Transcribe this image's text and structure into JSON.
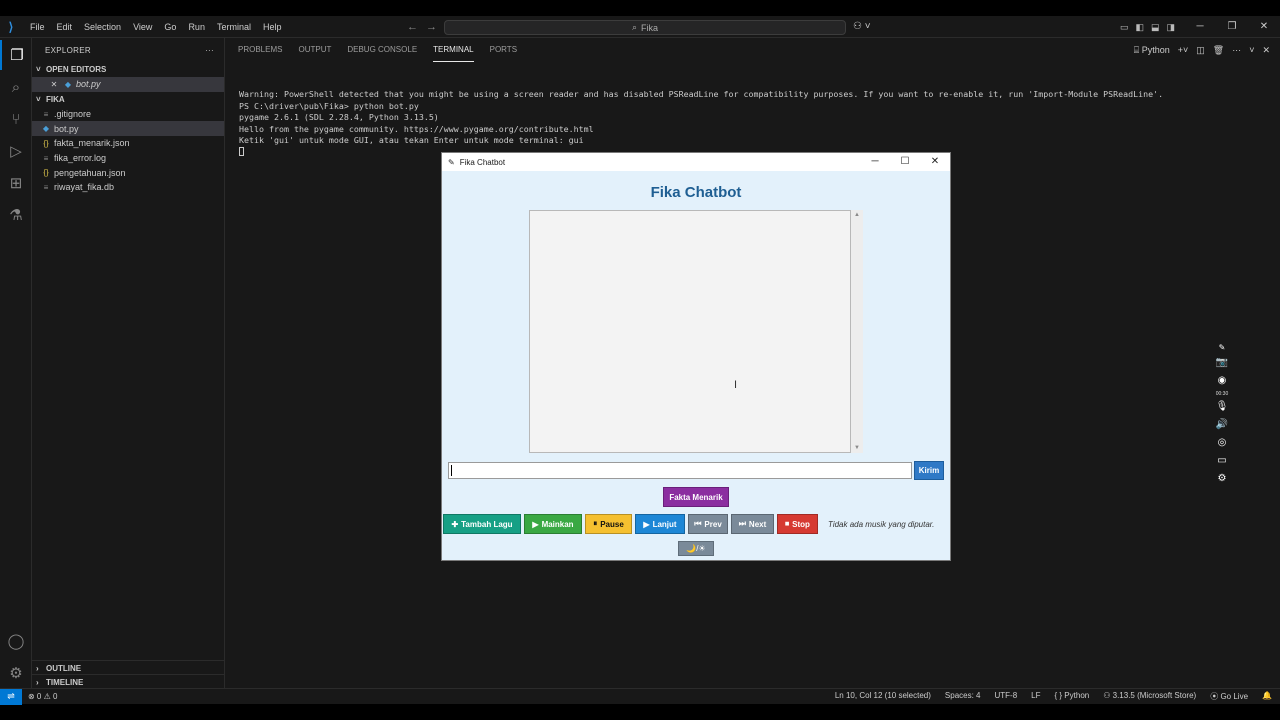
{
  "titlebar": {
    "menu": [
      "File",
      "Edit",
      "Selection",
      "View",
      "Go",
      "Run",
      "Terminal",
      "Help"
    ],
    "search": "Fika"
  },
  "explorer": {
    "title": "EXPLORER",
    "more": "···",
    "open_editors_label": "OPEN EDITORS",
    "open_editors": [
      {
        "name": "bot.py"
      }
    ],
    "folder_label": "FIKA",
    "files": [
      {
        "name": ".gitignore",
        "icon": "≡"
      },
      {
        "name": "bot.py",
        "icon": "◆"
      },
      {
        "name": "fakta_menarik.json",
        "icon": "{}"
      },
      {
        "name": "fika_error.log",
        "icon": "≡"
      },
      {
        "name": "pengetahuan.json",
        "icon": "{}"
      },
      {
        "name": "riwayat_fika.db",
        "icon": "≡"
      }
    ],
    "outline": "OUTLINE",
    "timeline": "TIMELINE"
  },
  "panel": {
    "tabs": [
      "PROBLEMS",
      "OUTPUT",
      "DEBUG CONSOLE",
      "TERMINAL",
      "PORTS"
    ],
    "active_tab": "TERMINAL",
    "shell": "Python",
    "terminal_lines": [
      "Warning: PowerShell detected that you might be using a screen reader and has disabled PSReadLine for compatibility purposes. If you want to re-enable it, run 'Import-Module PSReadLine'.",
      "",
      "PS C:\\driver\\pub\\Fika> python bot.py",
      "pygame 2.6.1 (SDL 2.28.4, Python 3.13.5)",
      "Hello from the pygame community. https://www.pygame.org/contribute.html",
      "Ketik 'gui' untuk mode GUI, atau tekan Enter untuk mode terminal: gui"
    ]
  },
  "recorder": {
    "timer": "00:30"
  },
  "statusbar": {
    "problems": "⊗ 0 ⚠ 0",
    "position": "Ln 10, Col 12 (10 selected)",
    "spaces": "Spaces: 4",
    "encoding": "UTF-8",
    "eol": "LF",
    "language": "{ } Python",
    "interpreter": "3.13.5 (Microsoft Store)",
    "golive": "Go Live"
  },
  "fika_app": {
    "window_title": "Fika Chatbot",
    "heading": "Fika Chatbot",
    "input_value": "",
    "send_label": "Kirim",
    "fakta_label": "Fakta Menarik",
    "buttons": {
      "add": "Tambah Lagu",
      "play": "Mainkan",
      "pause": "Pause",
      "next_track": "Lanjut",
      "prev": "Prev",
      "next": "Next",
      "stop": "Stop"
    },
    "music_status": "Tidak ada musik yang diputar.",
    "theme_toggle": "🌙/☀"
  },
  "colors": {
    "accent": "#0078d4",
    "fika_bg": "#e3f1fb",
    "heading": "#1f5f93",
    "send": "#2f79c6",
    "fakta": "#8b2ea0",
    "add": "#16a085",
    "play": "#3aa843",
    "pause": "#f5c030",
    "lanjut": "#1d87d6",
    "nav": "#7a8a99",
    "stop": "#d63a32"
  }
}
